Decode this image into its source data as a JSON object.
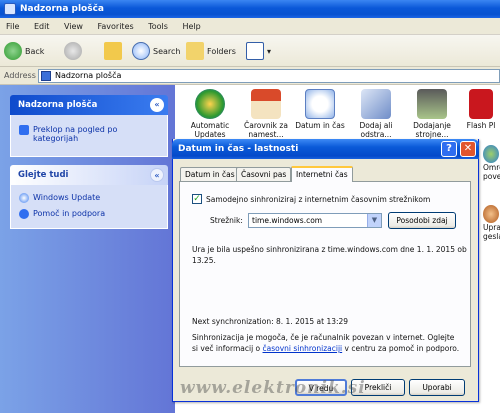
{
  "window": {
    "title": "Nadzorna plošča"
  },
  "menu": [
    "File",
    "Edit",
    "View",
    "Favorites",
    "Tools",
    "Help"
  ],
  "toolbar": {
    "back": "Back",
    "search": "Search",
    "folders": "Folders"
  },
  "address": {
    "label": "Address",
    "value": "Nadzorna plošča"
  },
  "sidebar": {
    "panel1": {
      "title": "Nadzorna plošča",
      "items": [
        "Preklop na pogled po kategorijah"
      ]
    },
    "panel2": {
      "title": "Glejte tudi",
      "items": [
        "Windows Update",
        "Pomoč in podpora"
      ]
    }
  },
  "content": {
    "icons": [
      "Automatic Updates",
      "Čarovnik za namest...",
      "Datum in čas",
      "Dodaj ali odstra...",
      "Dodajanje strojne...",
      "Flash Pl"
    ],
    "right_edge": [
      "Omre",
      "pove",
      "Upra",
      "gesla"
    ]
  },
  "dialog": {
    "title": "Datum in čas - lastnosti",
    "help_btn": "?",
    "close_btn": "✕",
    "tabs": [
      "Datum in čas",
      "Časovni pas",
      "Internetni čas"
    ],
    "active_tab": 2,
    "checkbox_label": "Samodejno sinhroniziraj z internetnim časovnim strežnikom",
    "server_label": "Strežnik:",
    "server_value": "time.windows.com",
    "update_btn": "Posodobi zdaj",
    "status_line1": "Ura je bila uspešno sinhronizirana z time.windows.com dne 1. 1. 2015 ob",
    "status_line2": "13.25.",
    "next_sync": "Next synchronization: 8. 1. 2015 at 13:29",
    "info_line1": "Sinhronizacija je mogoča, če je računalnik povezan v internet. Oglejte",
    "info_line2_pre": "si več informacij o ",
    "info_link": "časovni sinhronizaciji",
    "info_line2_post": " v centru za pomoč in podporo.",
    "ok_btn": "V redu",
    "cancel_btn": "Prekliči",
    "apply_btn": "Uporabi"
  },
  "watermark": "www.elektronik.si"
}
